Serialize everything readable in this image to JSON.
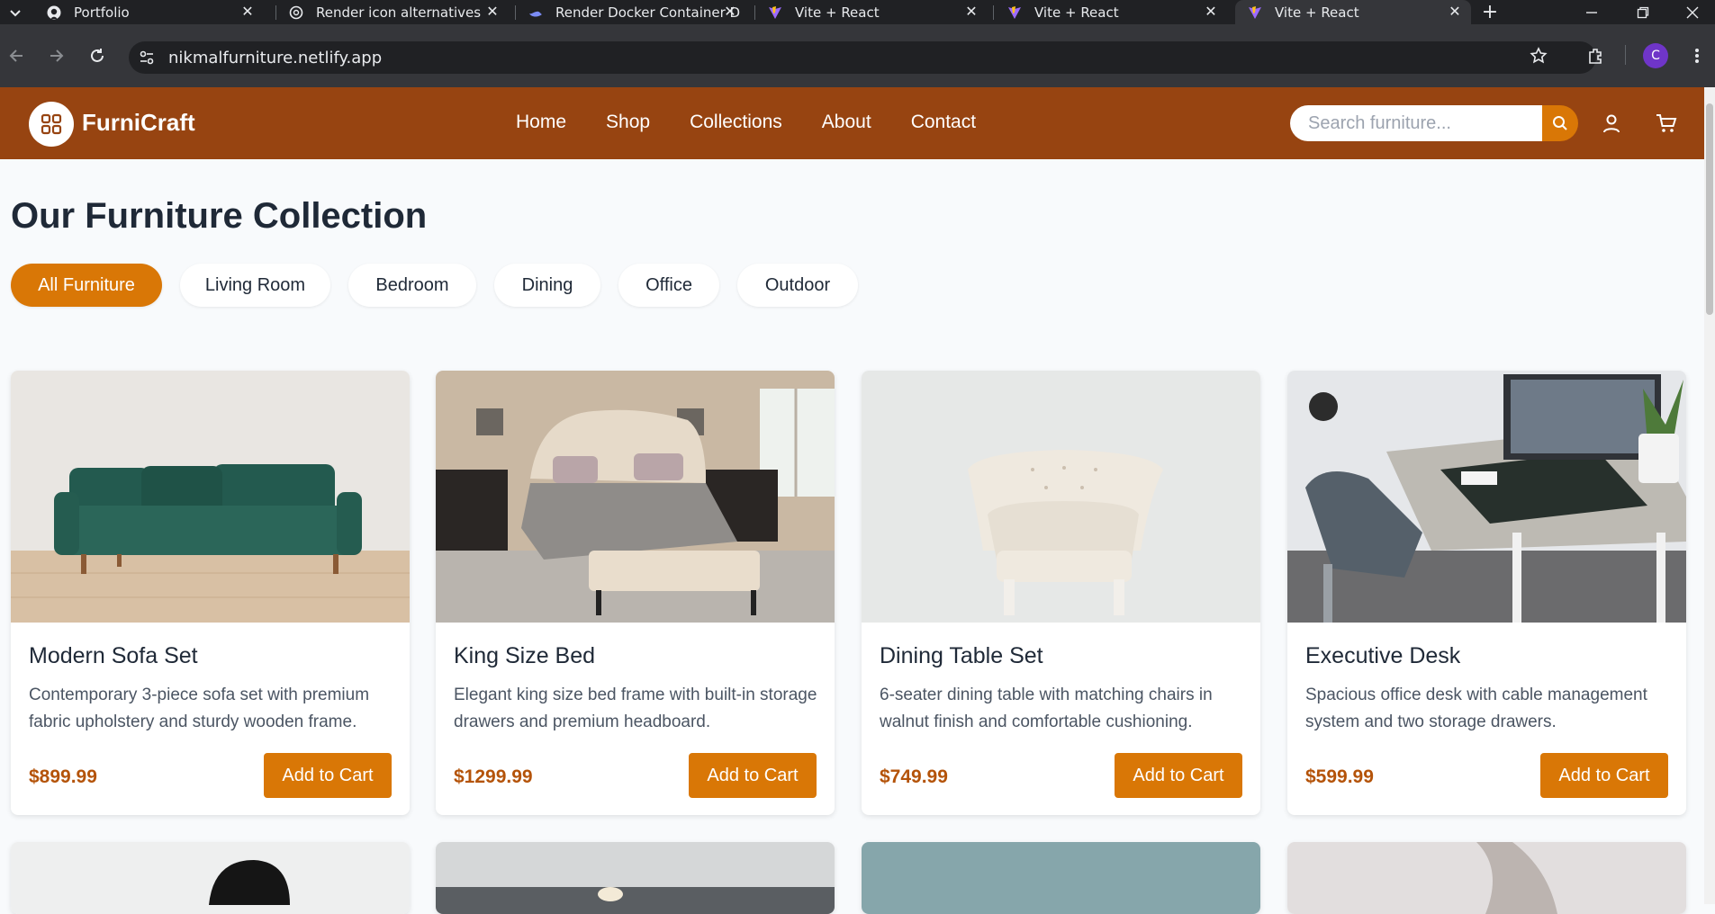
{
  "browser": {
    "tabs": [
      {
        "label": "Portfolio",
        "icon": "github-icon"
      },
      {
        "label": "Render icon alternatives",
        "icon": "chatgpt-icon"
      },
      {
        "label": "Render Docker Container D",
        "icon": "docker-icon"
      },
      {
        "label": "Vite + React",
        "icon": "vite-icon"
      },
      {
        "label": "Vite + React",
        "icon": "vite-icon"
      },
      {
        "label": "Vite + React",
        "icon": "vite-icon"
      }
    ],
    "url": "nikmalfurniture.netlify.app",
    "profile_initial": "C"
  },
  "header": {
    "brand": "FurniCraft",
    "nav": [
      "Home",
      "Shop",
      "Collections",
      "About",
      "Contact"
    ],
    "search_placeholder": "Search furniture..."
  },
  "main": {
    "title": "Our Furniture Collection",
    "filters": [
      "All Furniture",
      "Living Room",
      "Bedroom",
      "Dining",
      "Office",
      "Outdoor"
    ],
    "active_filter": "All Furniture",
    "products": [
      {
        "name": "Modern Sofa Set",
        "description": "Contemporary 3-piece sofa set with premium fabric upholstery and sturdy wooden frame.",
        "price": "$899.99",
        "button": "Add to Cart"
      },
      {
        "name": "King Size Bed",
        "description": "Elegant king size bed frame with built-in storage drawers and premium headboard.",
        "price": "$1299.99",
        "button": "Add to Cart"
      },
      {
        "name": "Dining Table Set",
        "description": "6-seater dining table with matching chairs in walnut finish and comfortable cushioning.",
        "price": "$749.99",
        "button": "Add to Cart"
      },
      {
        "name": "Executive Desk",
        "description": "Spacious office desk with cable management system and two storage drawers.",
        "price": "$599.99",
        "button": "Add to Cart"
      }
    ]
  },
  "colors": {
    "header": "#974411",
    "accent": "#d97706",
    "price": "#b45309"
  }
}
